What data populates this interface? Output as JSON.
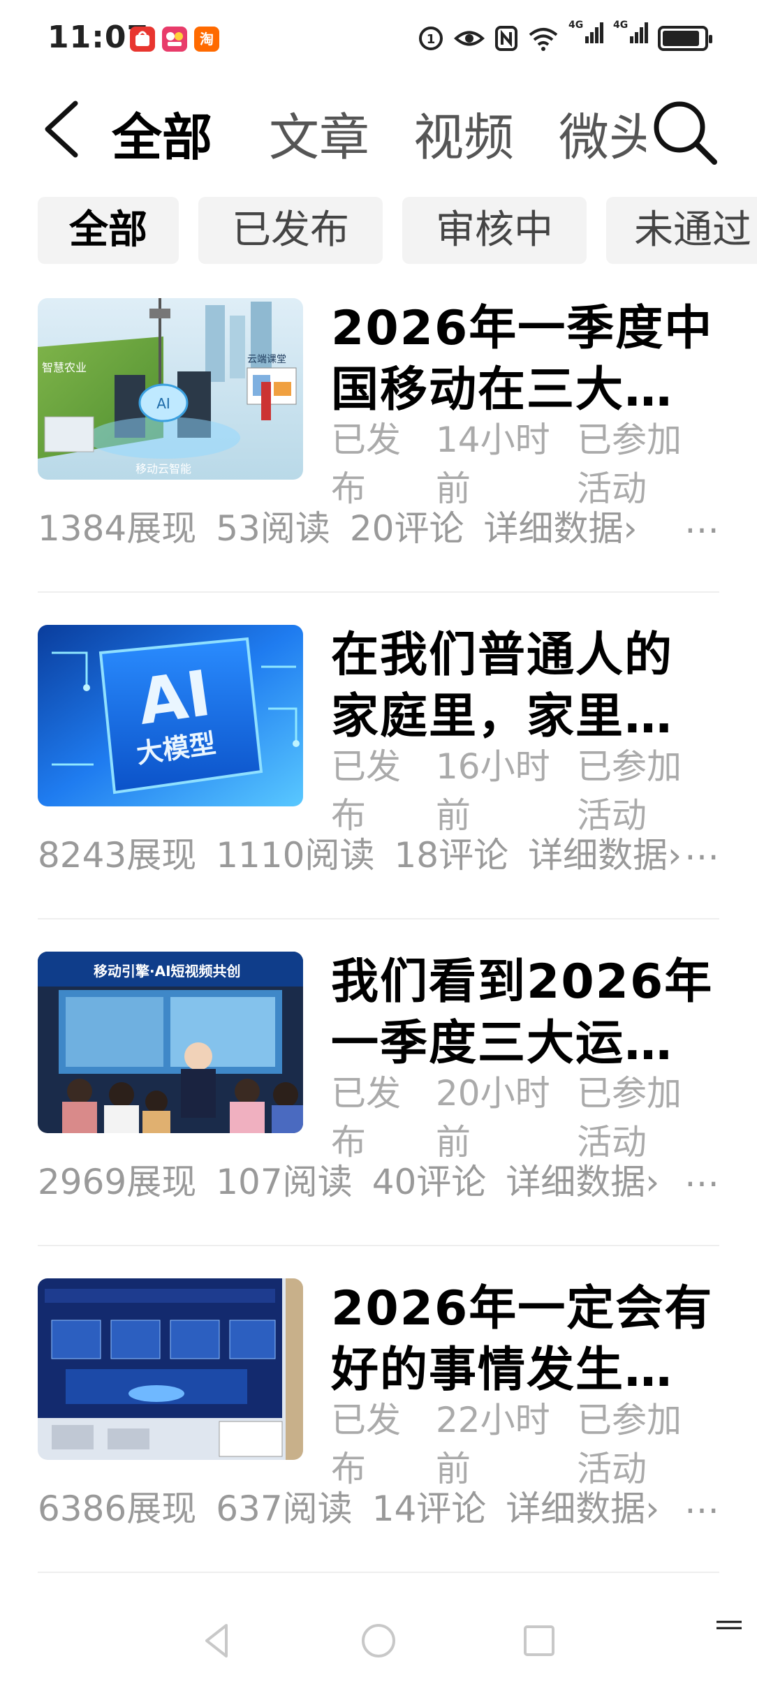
{
  "status": {
    "time": "11:07",
    "apps": [
      {
        "icon": "shopping-app-icon",
        "color": "#e8352f"
      },
      {
        "icon": "video-app-icon",
        "color": "#e83b6a"
      },
      {
        "icon": "taobao-icon",
        "label": "淘",
        "color": "#ff6a00"
      }
    ],
    "indicators": [
      "do-not-disturb-icon",
      "eye-comfort-icon",
      "nfc-icon",
      "wifi-icon",
      "4g-signal-icon",
      "4g-signal-icon",
      "battery-icon"
    ],
    "signal_label": "4G",
    "battery_level": 0.9
  },
  "nav": {
    "tabs": [
      "全部",
      "文章",
      "视频",
      "微头"
    ],
    "active_tab": 0
  },
  "filters": {
    "chips": [
      "全部",
      "已发布",
      "审核中",
      "未通过"
    ],
    "active_chip": 0
  },
  "articles": [
    {
      "title_lines": [
        "2026年一季度中",
        "国移动在三大…"
      ],
      "status": "已发布",
      "time": "14小时前",
      "activity": "已参加活动",
      "views": "1384展现",
      "reads": "53阅读",
      "comments": "20评论",
      "detail": "详细数据›",
      "more": "…",
      "thumb_labels": [
        "智慧农业",
        "云端课堂",
        "移动云智能",
        "AI"
      ]
    },
    {
      "title_lines": [
        "在我们普通人的",
        "家庭里，家里…"
      ],
      "status": "已发布",
      "time": "16小时前",
      "activity": "已参加活动",
      "views": "8243展现",
      "reads": "1110阅读",
      "comments": "18评论",
      "detail": "详细数据›",
      "more": "…",
      "thumb_labels": [
        "AI",
        "大模型"
      ]
    },
    {
      "title_lines": [
        "我们看到2026年",
        "一季度三大运…"
      ],
      "status": "已发布",
      "time": "20小时前",
      "activity": "已参加活动",
      "views": "2969展现",
      "reads": "107阅读",
      "comments": "40评论",
      "detail": "详细数据›",
      "more": "…",
      "thumb_labels": [
        "移动引擎·AI短视频共创"
      ]
    },
    {
      "title_lines": [
        "2026年一定会有",
        "好的事情发生…"
      ],
      "status": "已发布",
      "time": "22小时前",
      "activity": "已参加活动",
      "views": "6386展现",
      "reads": "637阅读",
      "comments": "14评论",
      "detail": "详细数据›",
      "more": "…",
      "thumb_labels": []
    }
  ]
}
